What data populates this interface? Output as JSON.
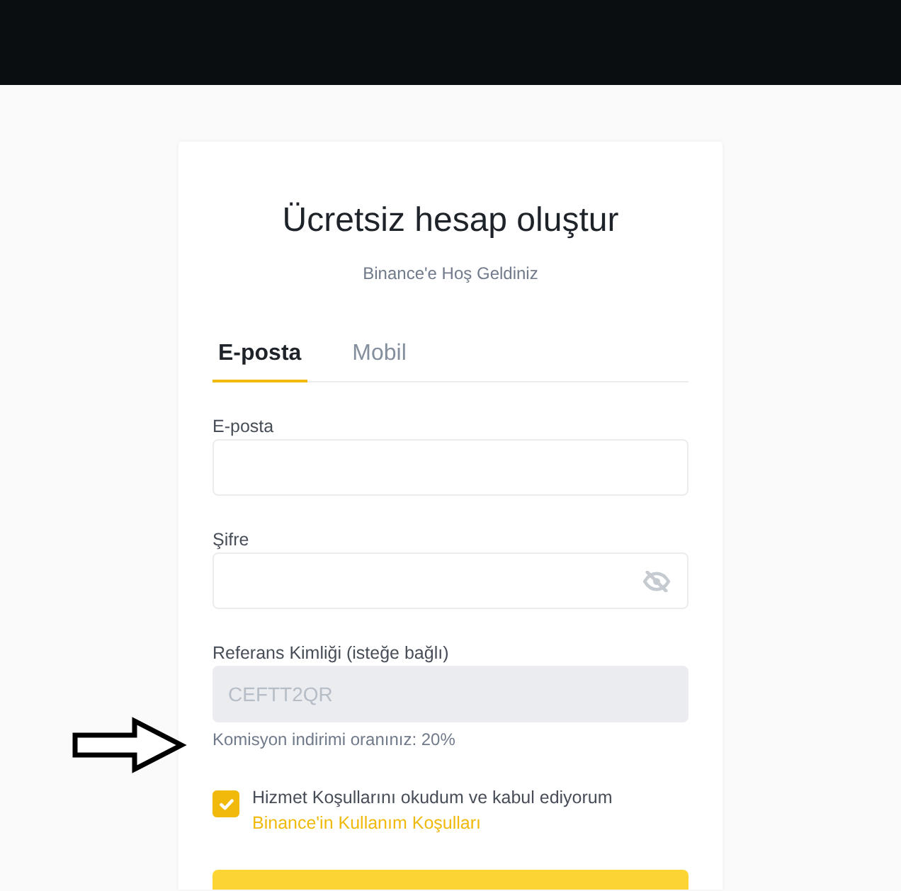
{
  "form": {
    "title": "Ücretsiz hesap oluştur",
    "subtitle": "Binance'e Hoş Geldiniz",
    "tabs": [
      {
        "label": "E-posta",
        "selected": true
      },
      {
        "label": "Mobil",
        "selected": false
      }
    ],
    "fields": [
      {
        "kind": "text",
        "label": "E-posta",
        "disabled": false
      },
      {
        "kind": "password",
        "label": "Şifre",
        "disabled": false
      },
      {
        "kind": "referral",
        "label": "Referans Kimliği (isteğe bağlı)",
        "value": "CEFTT2QR",
        "disabled": true,
        "hint": "Komisyon indirimi oranınız: 20%"
      }
    ],
    "terms": {
      "checked": true,
      "text": "Hizmet Koşullarını okudum ve kabul ediyorum",
      "link": "Binance'in Kullanım Koşulları"
    }
  }
}
